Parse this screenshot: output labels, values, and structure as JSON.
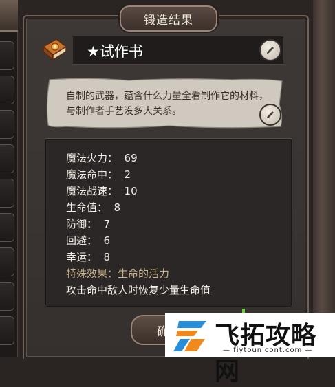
{
  "dialog": {
    "title": "锻造结果",
    "item_name": "★试作书",
    "description": "自制的武器，蕴含什么力量全看制作它的材料，与制作者手艺没多大关系。",
    "stats": [
      {
        "text": "魔法火力：  69"
      },
      {
        "text": "魔法命中：  2"
      },
      {
        "text": "魔法战速：  10"
      },
      {
        "text": "生命值：  8"
      },
      {
        "text": "防御：  7"
      },
      {
        "text": "回避：  6"
      },
      {
        "text": "幸运：  8"
      }
    ],
    "special_effect": "特殊效果：生命的活力",
    "special_desc": "攻击命中敌人时恢复少量生命值",
    "bottom_button": "确"
  },
  "watermark": {
    "text": "飞拓攻略网",
    "url": "— fiytounicont.com —"
  },
  "icons": {
    "item_icon": "spell-book-icon",
    "edit_icon": "pencil-icon"
  },
  "colors": {
    "panel_bg": "#3a3432",
    "special_text": "#c9b48f",
    "accent_green": "#6fd13c"
  }
}
